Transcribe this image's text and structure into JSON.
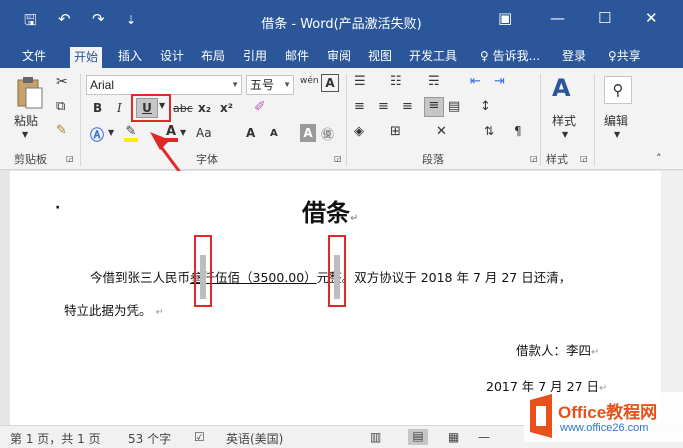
{
  "window": {
    "title": "借条 - Word(产品激活失败)",
    "qat": {
      "save": "🖫",
      "undo": "↶",
      "redo": "↷",
      "customize": "⇣"
    },
    "controls": {
      "ribbon_opts": "▣",
      "minimize": "—",
      "maximize": "☐",
      "close": "✕"
    }
  },
  "tabs": [
    {
      "label": "文件"
    },
    {
      "label": "开始"
    },
    {
      "label": "插入"
    },
    {
      "label": "设计"
    },
    {
      "label": "布局"
    },
    {
      "label": "引用"
    },
    {
      "label": "邮件"
    },
    {
      "label": "审阅"
    },
    {
      "label": "视图"
    },
    {
      "label": "开发工具"
    }
  ],
  "tell_me": "♀ 告诉我...",
  "login": "登录",
  "share": "♀共享",
  "ribbon": {
    "clipboard": {
      "paste": "粘贴",
      "label": "剪贴板"
    },
    "font": {
      "font_name": "Arial",
      "font_size": "五号",
      "wen": "wén",
      "A_box": "A",
      "bold": "B",
      "italic": "I",
      "underline": "U",
      "strike": "abc",
      "sub": "x₂",
      "sup": "x²",
      "grow": "A",
      "shrink": "A",
      "case": "Aa",
      "label": "字体"
    },
    "paragraph": {
      "label": "段落"
    },
    "styles": {
      "btn": "样式",
      "label": "样式"
    },
    "editing": {
      "btn": "编辑"
    }
  },
  "document": {
    "title": "借条",
    "line1_pre": "今借到张三人民币",
    "line1_amount": "叁仟伍佰（3500.00）",
    "line1_post": "元整。双方协议于 2018 年 7 月 27 日还清，",
    "line2": "特立此据为凭。",
    "borrower": "借款人：李四",
    "date": "2017 年 7 月 27 日",
    "para_mark": "↵"
  },
  "status": {
    "page": "第 1 页，共 1 页",
    "words": "53 个字",
    "proof": "☑",
    "lang": "英语(美国)",
    "zoom": "—"
  },
  "watermark": {
    "brand": "Office教程网",
    "url": "www.office26.com"
  }
}
